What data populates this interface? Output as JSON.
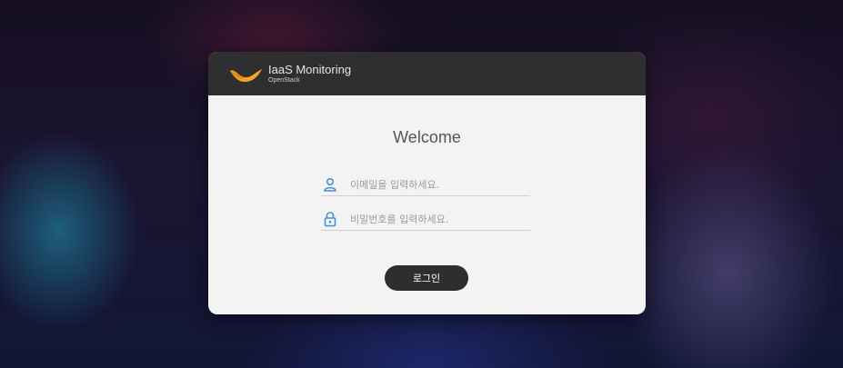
{
  "app": {
    "title": "IaaS Monitoring",
    "subtitle": "OpenStack"
  },
  "login": {
    "heading": "Welcome",
    "email_placeholder": "이메일을 입력하세요.",
    "password_placeholder": "비밀번호를 입력하세요.",
    "submit_label": "로그인"
  },
  "icons": {
    "logo": "wave-logo-icon",
    "email": "user-icon",
    "password": "lock-icon"
  },
  "colors": {
    "header_bg": "#2f2f31",
    "card_bg": "#f3f3f3",
    "logo_orange": "#f5a623",
    "icon_blue": "#4a90d9",
    "button_bg": "#2e2e2e"
  }
}
